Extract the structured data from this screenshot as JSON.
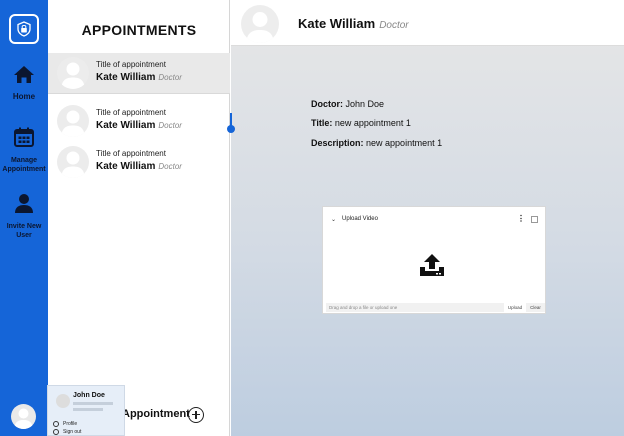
{
  "rail": {
    "icons": {
      "logo": "lock-shield-icon",
      "home": "home-icon",
      "manage": "calendar-icon",
      "invite": "user-icon"
    },
    "items": [
      {
        "label": "Home"
      },
      {
        "label": "Manage Appointment"
      },
      {
        "label": "Invite New User"
      }
    ]
  },
  "appointments": {
    "title": "APPOINTMENTS",
    "items": [
      {
        "title": "Title of appointment",
        "name": "Kate William",
        "role": "Doctor"
      },
      {
        "title": "Title of appointment",
        "name": "Kate William",
        "role": "Doctor"
      },
      {
        "title": "Title of appointment",
        "name": "Kate William",
        "role": "Doctor"
      }
    ],
    "new_button_label": "Appointment"
  },
  "header": {
    "name": "Kate William",
    "role": "Doctor"
  },
  "details": {
    "doctor_label": "Doctor:",
    "doctor_value": "John Doe",
    "title_label": "Title:",
    "title_value": "new appointment 1",
    "description_label": "Description:",
    "description_value": "new appointment 1"
  },
  "upload": {
    "title": "Upload Video",
    "input_placeholder": "Drag and drop a file or upload one",
    "upload_label": "Upload",
    "clear_label": "Clear",
    "icon": "upload-icon"
  },
  "profile_popup": {
    "name": "John Doe",
    "menu": [
      {
        "label": "Profile"
      },
      {
        "label": "Sign out"
      }
    ]
  },
  "colors": {
    "accent": "#1565d8",
    "selected_row": "#e9e9e9"
  }
}
